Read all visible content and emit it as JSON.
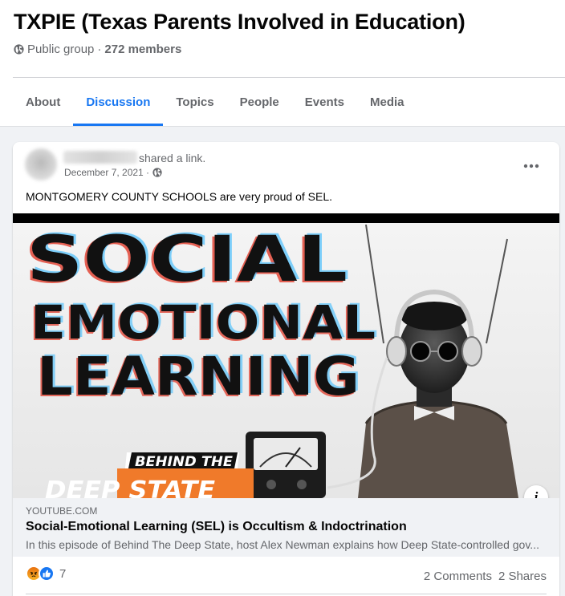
{
  "group": {
    "title": "TXPIE (Texas Parents Involved in Education)",
    "privacy": "Public group",
    "separator": "·",
    "members": "272 members"
  },
  "tabs": [
    {
      "label": "About"
    },
    {
      "label": "Discussion",
      "active": true
    },
    {
      "label": "Topics"
    },
    {
      "label": "People"
    },
    {
      "label": "Events"
    },
    {
      "label": "Media"
    }
  ],
  "post": {
    "action": "shared a link.",
    "date": "December 7, 2021 ·",
    "text": "MONTGOMERY COUNTY SCHOOLS are very proud of SEL.",
    "thumbnail": {
      "line1": "SOCIAL",
      "line2": "EMOTIONAL",
      "line3": "LEARNING",
      "banner1": "BEHIND THE",
      "banner2": "DEEP STATE"
    },
    "link": {
      "domain": "YOUTUBE.COM",
      "title": "Social-Emotional Learning (SEL) is Occultism & Indoctrination",
      "description": "In this episode of Behind The Deep State, host Alex Newman explains how Deep State-controlled gov..."
    },
    "reactions": {
      "count": "7",
      "types": [
        "angry",
        "like"
      ]
    },
    "comments": "2 Comments",
    "shares": "2 Shares"
  },
  "colors": {
    "accent": "#1877f2",
    "secondary_text": "#65676b",
    "background": "#f0f2f5"
  },
  "icons": [
    "globe-icon",
    "more-options-icon",
    "info-icon",
    "angry-reaction-icon",
    "like-reaction-icon"
  ]
}
